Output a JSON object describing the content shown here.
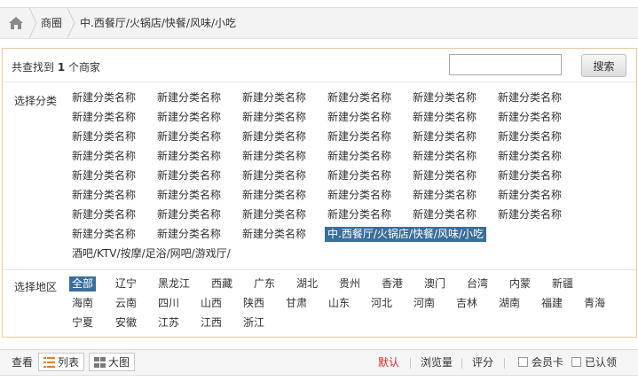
{
  "breadcrumb": {
    "items": [
      "商圈",
      "中.西餐厅/火锅店/快餐/风味/小吃"
    ]
  },
  "search": {
    "result_prefix": "共查找到",
    "result_count": "1",
    "result_suffix": "个商家",
    "placeholder": "",
    "button_label": "搜索"
  },
  "category": {
    "label": "选择分类",
    "placeholder_name": "新建分类名称",
    "selected": "中.西餐厅/火锅店/快餐/风味/小吃",
    "extra": "酒吧/KTV/按摩/足浴/网吧/游戏厅/"
  },
  "region": {
    "label": "选择地区",
    "rows": [
      [
        "全部",
        "辽宁",
        "黑龙江",
        "西藏",
        "广东",
        "湖北",
        "贵州",
        "香港",
        "澳门",
        "台湾",
        "内蒙",
        "新疆"
      ],
      [
        "海南",
        "云南",
        "四川",
        "山西",
        "陕西",
        "甘肃",
        "山东",
        "河北",
        "河南",
        "吉林",
        "湖南",
        "福建",
        "青海"
      ],
      [
        "宁夏",
        "安徽",
        "江苏",
        "江西",
        "浙江"
      ]
    ],
    "selected": "全部"
  },
  "view": {
    "label": "查看",
    "list_label": "列表",
    "grid_label": "大图"
  },
  "sort": {
    "default_label": "默认",
    "views_label": "浏览量",
    "rating_label": "评分",
    "member_card_label": "会员卡",
    "claimed_label": "已认领"
  },
  "colors": {
    "accent": "#3a6e9c",
    "active_sort": "#d12b2b",
    "panel_border": "#e8c9a0"
  }
}
